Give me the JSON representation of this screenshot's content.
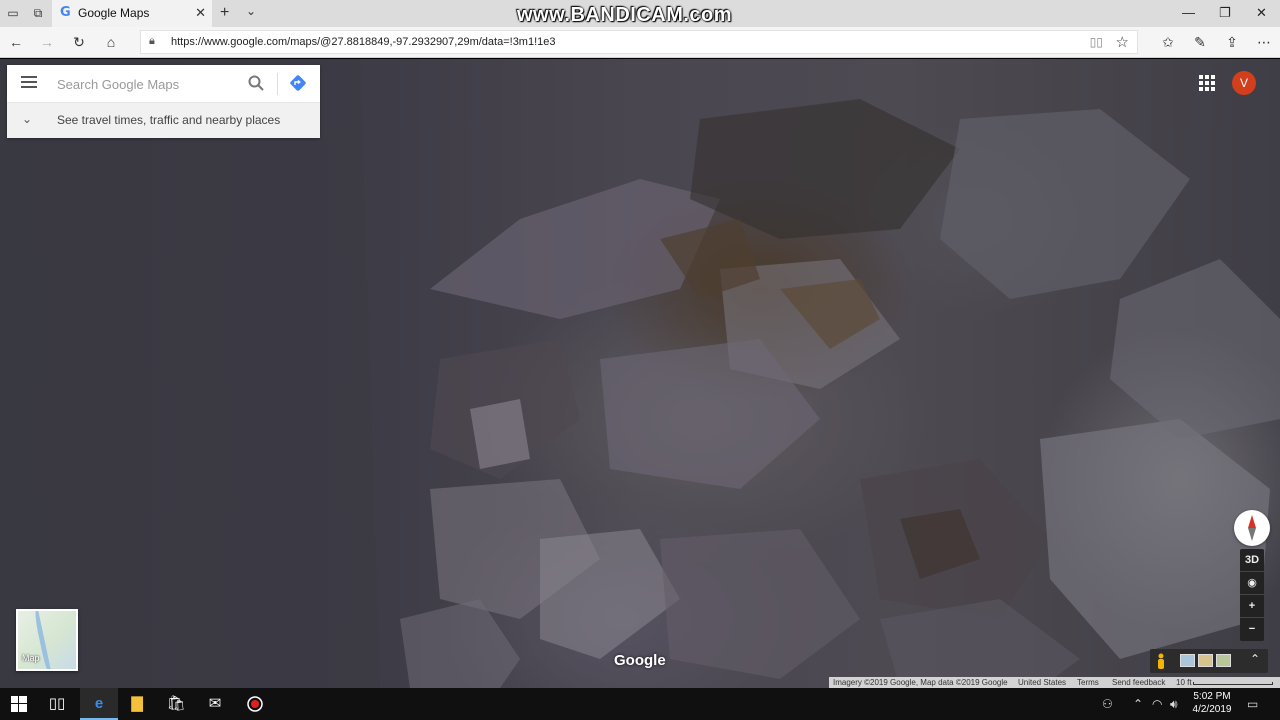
{
  "browser": {
    "tab_title": "Google Maps",
    "tab_favicon": "G",
    "url": "https://www.google.com/maps/@27.8818849,-97.2932907,29m/data=!3m1!1e3",
    "watermark": "www.BANDICAM.com",
    "icons": {
      "tab_actions": "tab-actions-icon",
      "set_aside": "set-aside-tabs-icon",
      "close_tab": "close-icon",
      "new_tab": "plus-icon",
      "tab_list": "chevron-down-icon",
      "back": "arrow-left-icon",
      "forward": "arrow-right-icon",
      "refresh": "refresh-icon",
      "home": "home-icon",
      "lock": "lock-icon",
      "reading_view": "book-icon",
      "favorite": "star-icon",
      "favorites_hub": "favorites-icon",
      "notes": "pen-icon",
      "share": "share-icon",
      "more": "ellipsis-icon"
    }
  },
  "maps": {
    "search_placeholder": "Search Google Maps",
    "travel_prompt": "See travel times, traffic and nearby places",
    "avatar_initial": "V",
    "brand": "Google",
    "minimap_label": "Map",
    "control_3d": "3D",
    "footer": {
      "imagery": "Imagery ©2019 Google, Map data ©2019 Google",
      "region": "United States",
      "terms": "Terms",
      "feedback": "Send feedback",
      "scale": "10 ft"
    },
    "colors": {
      "accent_blue": "#4285f4",
      "avatar": "#d23f1c",
      "compass_red": "#d93025"
    }
  },
  "taskbar": {
    "time": "5:02 PM",
    "date": "4/2/2019",
    "items": [
      "start-icon",
      "task-view-icon",
      "edge-icon",
      "file-explorer-icon",
      "store-icon",
      "mail-icon",
      "bandicam-icon"
    ]
  }
}
